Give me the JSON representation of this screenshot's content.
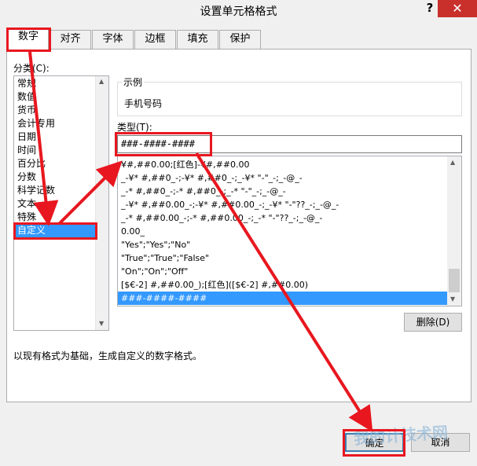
{
  "window": {
    "title": "设置单元格格式",
    "help": "?",
    "close": "✕"
  },
  "tabs": [
    "数字",
    "对齐",
    "字体",
    "边框",
    "填充",
    "保护"
  ],
  "category": {
    "label": "分类(C):",
    "items": [
      "常规",
      "数值",
      "货币",
      "会计专用",
      "日期",
      "时间",
      "百分比",
      "分数",
      "科学记数",
      "文本",
      "特殊",
      "自定义"
    ],
    "selected": "自定义"
  },
  "sample": {
    "label": "示例",
    "value": "手机号码"
  },
  "type": {
    "label": "类型(T):",
    "value": "###-####-####",
    "formats": [
      "¥#,##0.00;[红色]-¥#,##0.00",
      "_-¥* #,##0_-;-¥* #,##0_-;_-¥* \"-\"_-;_-@_-",
      "_-* #,##0_-;-* #,##0_-;_-* \"-\"_-;_-@_-",
      "_-¥* #,##0.00_-;-¥* #,##0.00_-;_-¥* \"-\"??_-;_-@_-",
      "_-* #,##0.00_-;-* #,##0.00_-;_-* \"-\"??_-;_-@_-",
      "0.00_",
      "\"Yes\";\"Yes\";\"No\"",
      "\"True\";\"True\";\"False\"",
      "\"On\";\"On\";\"Off\"",
      "[$€-2] #,##0.00_);[红色]([$€-2] #,##0.00)",
      "###-####-####"
    ]
  },
  "buttons": {
    "delete": "删除(D)",
    "ok": "确定",
    "cancel": "取消"
  },
  "hint": "以现有格式为基础，生成自定义的数字格式。",
  "watermark": "我的计技术网",
  "annotation_color": "#e8171f",
  "selection_color": "#3399ff"
}
